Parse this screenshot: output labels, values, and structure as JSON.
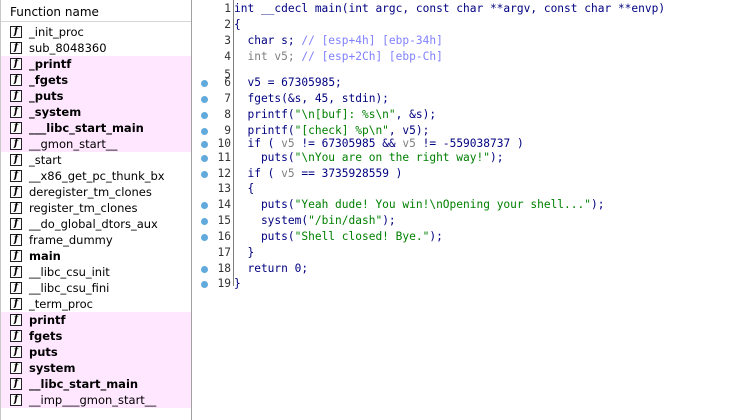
{
  "function_panel": {
    "header": "Function name",
    "icon_glyph": "f",
    "items": [
      {
        "name": "_init_proc",
        "highlight": false,
        "bold": false
      },
      {
        "name": "sub_8048360",
        "highlight": false,
        "bold": false
      },
      {
        "name": "_printf",
        "highlight": true,
        "bold": true
      },
      {
        "name": "_fgets",
        "highlight": true,
        "bold": true
      },
      {
        "name": "_puts",
        "highlight": true,
        "bold": true
      },
      {
        "name": "_system",
        "highlight": true,
        "bold": true
      },
      {
        "name": "___libc_start_main",
        "highlight": true,
        "bold": true
      },
      {
        "name": "__gmon_start__",
        "highlight": true,
        "bold": false
      },
      {
        "name": "_start",
        "highlight": false,
        "bold": false
      },
      {
        "name": "__x86_get_pc_thunk_bx",
        "highlight": false,
        "bold": false
      },
      {
        "name": "deregister_tm_clones",
        "highlight": false,
        "bold": false
      },
      {
        "name": "register_tm_clones",
        "highlight": false,
        "bold": false
      },
      {
        "name": "__do_global_dtors_aux",
        "highlight": false,
        "bold": false
      },
      {
        "name": "frame_dummy",
        "highlight": false,
        "bold": false
      },
      {
        "name": "main",
        "highlight": false,
        "bold": true
      },
      {
        "name": "__libc_csu_init",
        "highlight": false,
        "bold": false
      },
      {
        "name": "__libc_csu_fini",
        "highlight": false,
        "bold": false
      },
      {
        "name": "_term_proc",
        "highlight": false,
        "bold": false
      },
      {
        "name": "printf",
        "highlight": true,
        "bold": true
      },
      {
        "name": "fgets",
        "highlight": true,
        "bold": true
      },
      {
        "name": "puts",
        "highlight": true,
        "bold": true
      },
      {
        "name": "system",
        "highlight": true,
        "bold": true
      },
      {
        "name": "__libc_start_main",
        "highlight": true,
        "bold": true
      },
      {
        "name": "__imp___gmon_start__",
        "highlight": true,
        "bold": false
      }
    ]
  },
  "code": {
    "lines": [
      {
        "n": "1",
        "bp": false,
        "segs": [
          [
            "int __cdecl main(int argc, const char **argv, const char **envp)",
            "k"
          ]
        ]
      },
      {
        "n": "2",
        "bp": false,
        "segs": [
          [
            "{",
            "k"
          ]
        ]
      },
      {
        "n": "3",
        "bp": false,
        "segs": [
          [
            "  char s; ",
            "k"
          ],
          [
            "// [esp+4h] [ebp-34h]",
            "c"
          ]
        ]
      },
      {
        "n": "4",
        "bp": false,
        "segs": [
          [
            "  int v5; ",
            "g"
          ],
          [
            "// [esp+2Ch] [ebp-Ch]",
            "c"
          ]
        ]
      },
      {
        "n": "5",
        "bp": false,
        "segs": [
          [
            "",
            "k"
          ]
        ]
      },
      {
        "n": "6",
        "bp": true,
        "segs": [
          [
            "  ",
            "k"
          ],
          [
            "v5",
            "v"
          ],
          [
            " = 67305985;",
            "k"
          ]
        ]
      },
      {
        "n": "7",
        "bp": true,
        "segs": [
          [
            "  fgets(&s, 45, stdin);",
            "k"
          ]
        ]
      },
      {
        "n": "8",
        "bp": true,
        "segs": [
          [
            "  printf(",
            "k"
          ],
          [
            "\"\\n[buf]: %s\\n\"",
            "s"
          ],
          [
            ", &s);",
            "k"
          ]
        ]
      },
      {
        "n": "9",
        "bp": true,
        "segs": [
          [
            "  printf(",
            "k"
          ],
          [
            "\"[check] %p\\n\"",
            "s"
          ],
          [
            ", v5);",
            "k"
          ]
        ]
      },
      {
        "n": "10",
        "bp": true,
        "segs": [
          [
            "  if ( ",
            "k"
          ],
          [
            "v5",
            "g"
          ],
          [
            " != 67305985 && ",
            "k"
          ],
          [
            "v5",
            "g"
          ],
          [
            " != -559038737 )",
            "k"
          ]
        ]
      },
      {
        "n": "11",
        "bp": true,
        "segs": [
          [
            "    puts(",
            "k"
          ],
          [
            "\"\\nYou are on the right way!\"",
            "s"
          ],
          [
            ");",
            "k"
          ]
        ]
      },
      {
        "n": "12",
        "bp": true,
        "segs": [
          [
            "  if ( ",
            "k"
          ],
          [
            "v5",
            "g"
          ],
          [
            " == 3735928559 )",
            "k"
          ]
        ]
      },
      {
        "n": "13",
        "bp": false,
        "segs": [
          [
            "  {",
            "k"
          ]
        ]
      },
      {
        "n": "14",
        "bp": true,
        "segs": [
          [
            "    puts(",
            "k"
          ],
          [
            "\"Yeah dude! You win!\\nOpening your shell...\"",
            "s"
          ],
          [
            ");",
            "k"
          ]
        ]
      },
      {
        "n": "15",
        "bp": true,
        "segs": [
          [
            "    system(",
            "k"
          ],
          [
            "\"/bin/dash\"",
            "s"
          ],
          [
            ");",
            "k"
          ]
        ]
      },
      {
        "n": "16",
        "bp": true,
        "segs": [
          [
            "    puts(",
            "k"
          ],
          [
            "\"Shell closed! Bye.\"",
            "s"
          ],
          [
            ");",
            "k"
          ]
        ]
      },
      {
        "n": "17",
        "bp": false,
        "segs": [
          [
            "  }",
            "k"
          ]
        ]
      },
      {
        "n": "18",
        "bp": true,
        "segs": [
          [
            "  return 0;",
            "k"
          ]
        ]
      },
      {
        "n": "19",
        "bp": true,
        "segs": [
          [
            "}",
            "k"
          ]
        ]
      }
    ]
  }
}
